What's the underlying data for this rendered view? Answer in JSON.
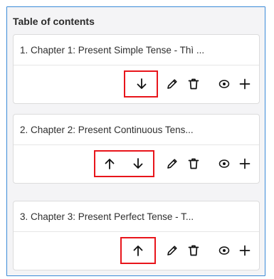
{
  "toc": {
    "heading": "Table of contents",
    "chapters": [
      {
        "title": "1. Chapter 1: Present Simple Tense - Thì ..."
      },
      {
        "title": "2. Chapter 2: Present Continuous Tens..."
      },
      {
        "title": "3. Chapter 3: Present Perfect Tense - T..."
      }
    ]
  },
  "icons": {
    "move_up": "arrow-up-icon",
    "move_down": "arrow-down-icon",
    "edit": "pencil-icon",
    "delete": "trash-icon",
    "preview": "eye-icon",
    "add": "plus-icon"
  },
  "colors": {
    "frame_border": "#3a8ad8",
    "highlight": "#e8151b",
    "card_bg": "#ffffff",
    "panel_bg": "#f4f4f6"
  }
}
